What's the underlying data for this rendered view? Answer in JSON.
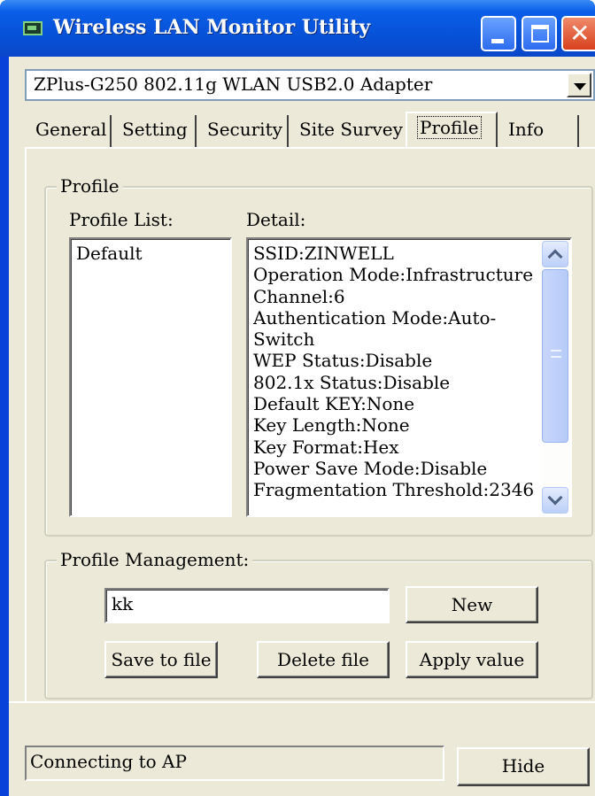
{
  "window": {
    "title": "Wireless LAN Monitor Utility",
    "icon": "wlan-adapter-icon",
    "controls": {
      "minimize": "minimize-icon",
      "maximize": "maximize-icon",
      "close": "close-icon",
      "close_glyph": "✕"
    }
  },
  "adapter": {
    "selected": "ZPlus-G250 802.11g WLAN USB2.0 Adapter"
  },
  "tabs": [
    {
      "label": "General"
    },
    {
      "label": "Setting"
    },
    {
      "label": "Security"
    },
    {
      "label": "Site Survey"
    },
    {
      "label": "Profile",
      "active": true
    },
    {
      "label": "Info"
    }
  ],
  "profile": {
    "group_label": "Profile",
    "list_label": "Profile List:",
    "detail_label": "Detail:",
    "list_items": [
      "Default"
    ],
    "detail_lines": [
      "SSID:ZINWELL",
      "Operation Mode:Infrastructure",
      "Channel:6",
      "Authentication Mode:Auto-",
      "Switch",
      "WEP Status:Disable",
      "802.1x Status:Disable",
      "Default KEY:None",
      "Key Length:None",
      "Key Format:Hex",
      "Power Save Mode:Disable",
      "Fragmentation Threshold:2346"
    ]
  },
  "management": {
    "group_label": "Profile Management:",
    "name_value": "kk",
    "new_label": "New",
    "save_label": "Save to file",
    "delete_label": "Delete file",
    "apply_label": "Apply value"
  },
  "status": {
    "text": "Connecting to AP",
    "hide_label": "Hide"
  },
  "colors": {
    "titlebar": "#0a5ee8",
    "face": "#ece9d8",
    "close_button": "#d8401c"
  }
}
